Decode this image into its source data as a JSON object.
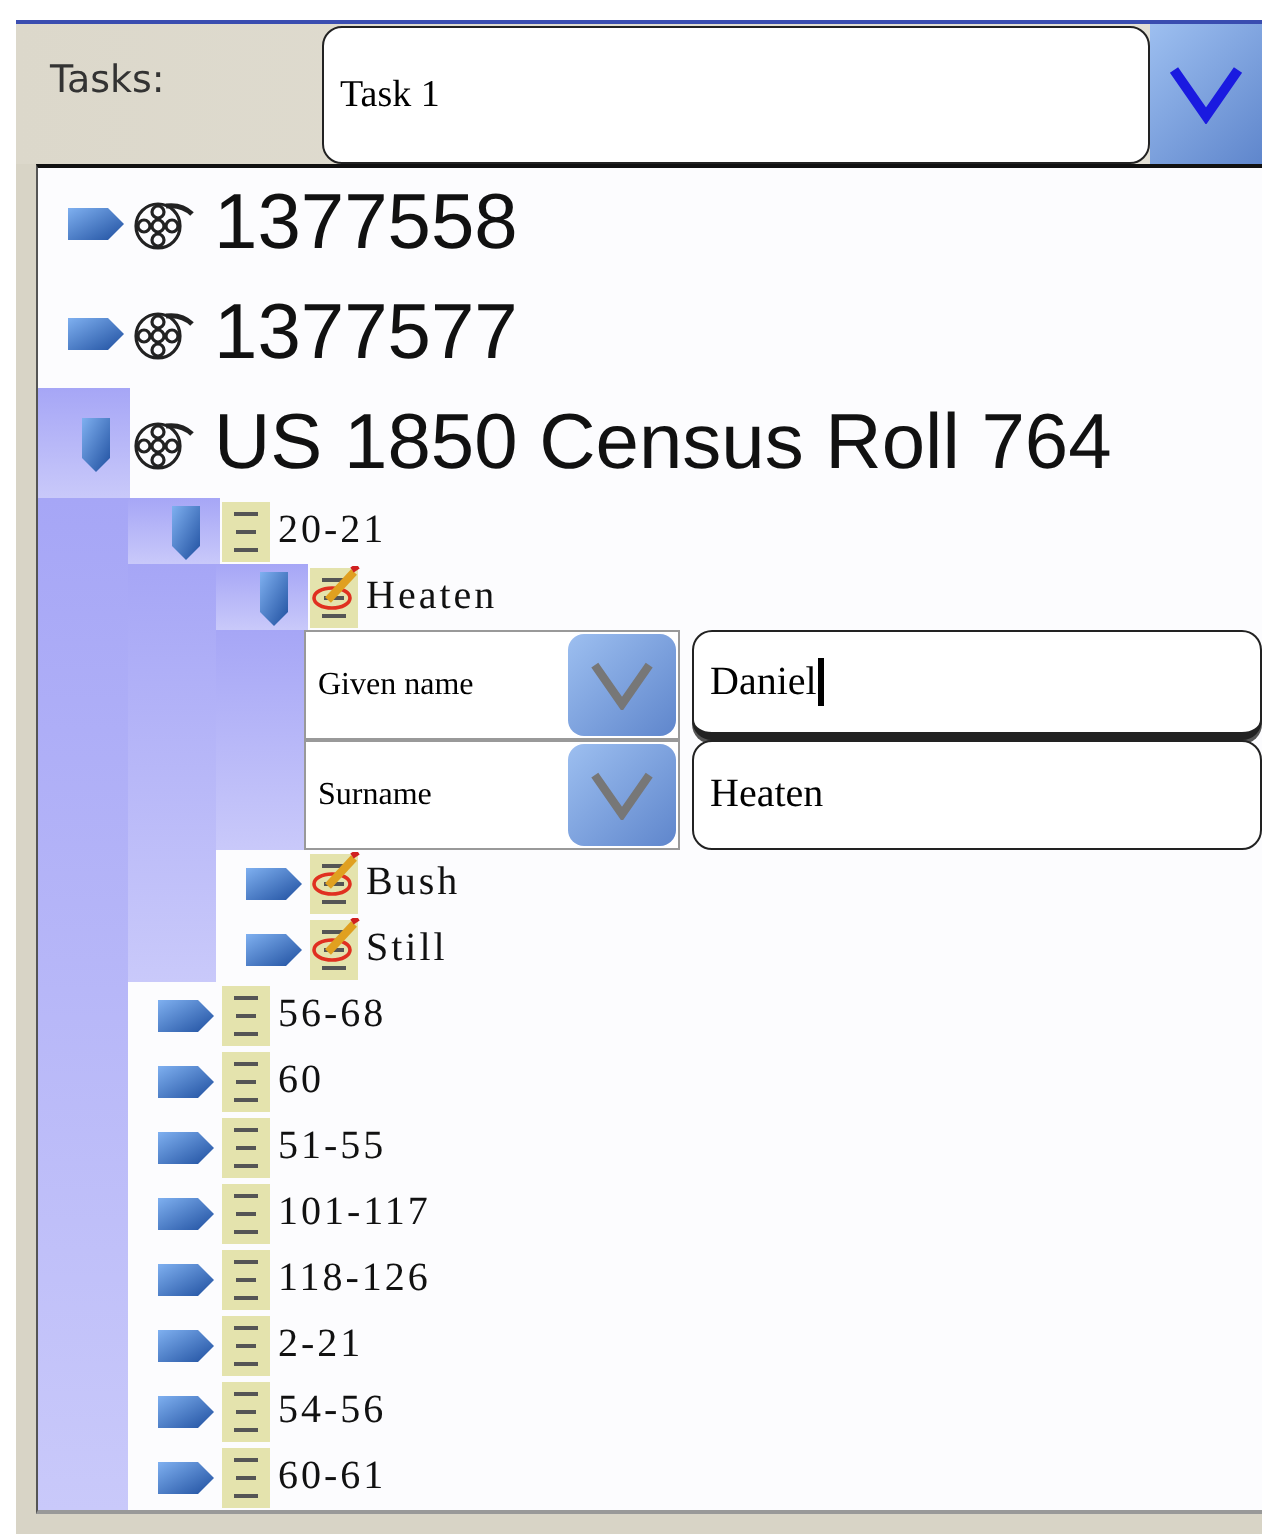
{
  "task_bar": {
    "label": "Tasks:",
    "value": "Task 1"
  },
  "tree": [
    {
      "kind": "film",
      "label": "1377558",
      "expanded": false
    },
    {
      "kind": "film",
      "label": "1377577",
      "expanded": false
    },
    {
      "kind": "film",
      "label": "US 1850 Census Roll 764",
      "expanded": true,
      "children": [
        {
          "kind": "page",
          "label": "20-21",
          "expanded": true,
          "children": [
            {
              "kind": "record",
              "label": "Heaten",
              "expanded": true,
              "fields": [
                {
                  "name": "Given name",
                  "value": "Daniel",
                  "focused": true
                },
                {
                  "name": "Surname",
                  "value": "Heaten",
                  "focused": false
                }
              ]
            },
            {
              "kind": "record",
              "label": "Bush",
              "expanded": false
            },
            {
              "kind": "record",
              "label": "Still",
              "expanded": false
            }
          ]
        },
        {
          "kind": "page",
          "label": "56-68",
          "expanded": false
        },
        {
          "kind": "page",
          "label": "60",
          "expanded": false
        },
        {
          "kind": "page",
          "label": "51-55",
          "expanded": false
        },
        {
          "kind": "page",
          "label": "101-117",
          "expanded": false
        },
        {
          "kind": "page",
          "label": "118-126",
          "expanded": false
        },
        {
          "kind": "page",
          "label": "2-21",
          "expanded": false
        },
        {
          "kind": "page",
          "label": "54-56",
          "expanded": false
        },
        {
          "kind": "page",
          "label": "60-61",
          "expanded": false
        }
      ]
    }
  ]
}
